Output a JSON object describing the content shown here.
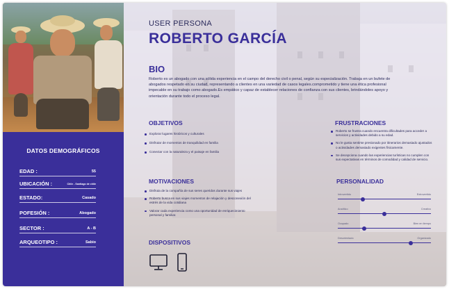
{
  "header": {
    "eyebrow": "USER PERSONA",
    "name": "ROBERTO GARCÍA"
  },
  "bio": {
    "title": "BIO",
    "text": "Roberto es un abogado con una sólida experiencia en el campo del derecho civil o penal, según su especialización. Trabaja en un bufete de abogados respetado en su ciudad, representando a clientes en una variedad de casos legales.comprometido y tiene una ética profesional impecable en su trabajo como abogado.Es empático y capaz de establecer relaciones de confianza con sus clientes, brindándoles apoyo y orientación durante todo el proceso legal."
  },
  "demographics": {
    "title": "DATOS DEMOGRÁFICOS",
    "rows": [
      {
        "key": "EDAD :",
        "value": "55"
      },
      {
        "key": "UBICACIÓN :",
        "value": "Chile - Santiago de chile"
      },
      {
        "key": "ESTADO:",
        "value": "Casado"
      },
      {
        "key": "POFESIÓN :",
        "value": "Abogado"
      },
      {
        "key": "SECTOR :",
        "value": "A - B"
      },
      {
        "key": "ARQUEOTIPO :",
        "value": "Sabio"
      }
    ]
  },
  "objectives": {
    "title": "OBJETIVOS",
    "items": [
      "Explorar lugares históricos y culturales",
      "Disfrutar de momentos de tranquilidad en familia",
      "Conectar con la naturaleza y el paisaje en familia"
    ]
  },
  "frustrations": {
    "title": "FRUSTRACIONES",
    "items": [
      "Roberto se frustra cuando encuentra dificultades para acceder a servicios y actividades debido a su edad.",
      "No le gusta sentirse presionado por itinerarios demasiado ajustados o actividades demasiado exigentes físicamente.",
      "Se decepciona cuando las experiencias turísticas no cumplen con sus expectativas en términos de comodidad y calidad de servicio."
    ]
  },
  "motivations": {
    "title": "MOTIVACIONES",
    "items": [
      "Disfruta de la compañía de sus seres queridos durante sus viajes",
      "Roberto busca en sus viajes momentos de relajación y desconexión del estrés de la vida cotidiana",
      "Valorar cada experiencia como una oportunidad de enriquecimiento personal y familiar."
    ]
  },
  "personality": {
    "title": "PERSONALIDAD",
    "sliders": [
      {
        "left": "Introvertido",
        "right": "Extrovertido",
        "value": 0.27
      },
      {
        "left": "Analítico",
        "right": "Creativo",
        "value": 0.5
      },
      {
        "left": "Ocupado",
        "right": "Bien en tiempo",
        "value": 0.28
      },
      {
        "left": "Desorientado",
        "right": "Organizado",
        "value": 0.78
      }
    ]
  },
  "devices": {
    "title": "DISPOSITIVOS",
    "icons": [
      "desktop-monitor-icon",
      "smartphone-icon"
    ]
  },
  "colors": {
    "accent": "#3a2f9a",
    "text": "#2b2b5c"
  }
}
